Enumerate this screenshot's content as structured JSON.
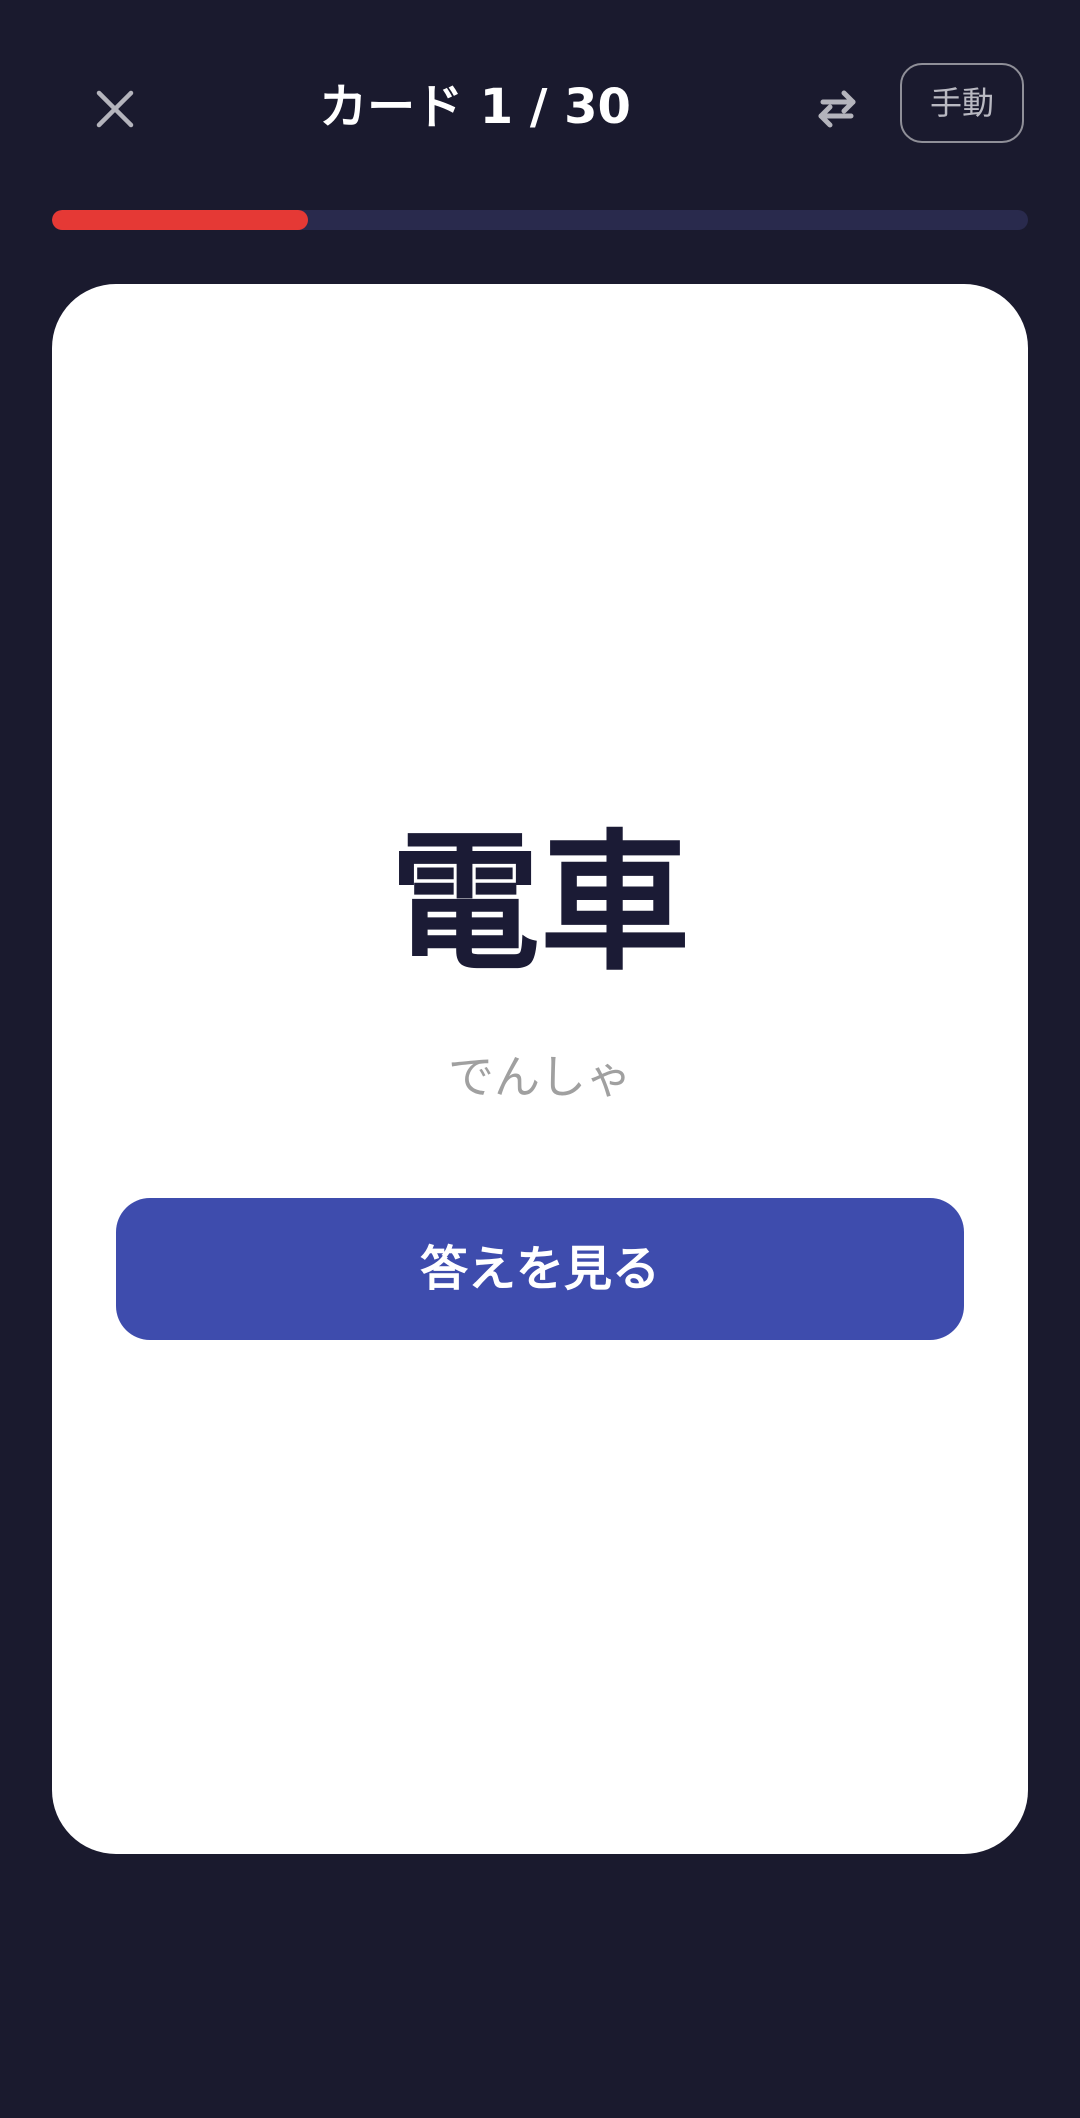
{
  "header": {
    "title": "カード 1 / 30",
    "mode_label": "手動",
    "close_icon": "close-icon",
    "swap_icon": "swap-icon"
  },
  "progress": {
    "current": 1,
    "total": 30,
    "fill_fraction": 0.262,
    "fill_color": "#e53935",
    "track_color": "#292a4d"
  },
  "card": {
    "word": "電車",
    "reading": "でんしゃ",
    "reveal_button_label": "答えを見る",
    "button_color": "#3e4cad"
  },
  "theme": {
    "background": "#1a1a2e",
    "card_background": "#ffffff"
  }
}
